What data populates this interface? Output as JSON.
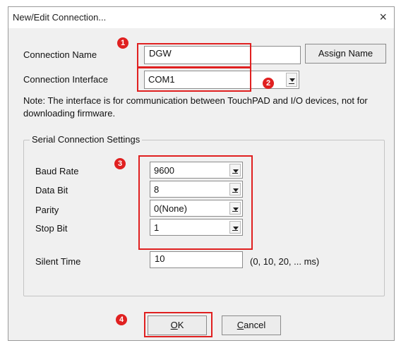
{
  "dialog": {
    "title": "New/Edit Connection...",
    "close_label": "×"
  },
  "connection": {
    "name_label": "Connection Name",
    "name_value": "DGW",
    "assign_button": "Assign Name",
    "interface_label": "Connection Interface",
    "interface_value": "COM1"
  },
  "note": "Note: The interface is for communication between TouchPAD and I/O devices, not for downloading firmware.",
  "serial": {
    "group_label": "Serial Connection Settings",
    "baud_label": "Baud Rate",
    "baud_value": "9600",
    "databit_label": "Data Bit",
    "databit_value": "8",
    "parity_label": "Parity",
    "parity_value": "0(None)",
    "stopbit_label": "Stop Bit",
    "stopbit_value": "1",
    "silent_label": "Silent Time",
    "silent_value": "10",
    "silent_hint": "(0, 10, 20, ... ms)"
  },
  "buttons": {
    "ok_first": "O",
    "ok_rest": "K",
    "cancel_first": "C",
    "cancel_rest": "ancel"
  },
  "callouts": [
    "1",
    "2",
    "3",
    "4"
  ],
  "colors": {
    "highlight": "#e02020",
    "dialog_bg": "#f0f0f0"
  }
}
